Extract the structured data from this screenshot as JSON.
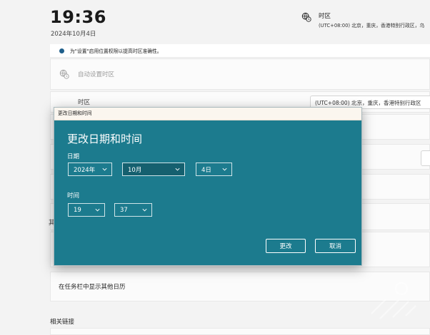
{
  "clock": {
    "time": "19:36",
    "date": "2024年10月4日"
  },
  "timezone_header": {
    "title": "时区",
    "value": "(UTC+08:00) 北京，重庆，香港特别行政区，乌"
  },
  "info_bar": {
    "text": "为\"设置\"启用位置权限以提高时区准确性。"
  },
  "auto_timezone": {
    "label": "自动设置时区"
  },
  "timezone_row": {
    "label": "时区",
    "selected": "(UTC+08:00) 北京，重庆，香港特别行政区"
  },
  "side_letter": "其",
  "calendar_row": {
    "label": "在任务栏中显示其他日历"
  },
  "related_links": {
    "label": "相关链接"
  },
  "dialog": {
    "window_title": "更改日期和时间",
    "heading": "更改日期和时间",
    "date_label": "日期",
    "time_label": "时间",
    "year": "2024年",
    "month": "10月",
    "day": "4日",
    "hour": "19",
    "minute": "37",
    "change_button": "更改",
    "cancel_button": "取消",
    "accent_color": "#1c7b8e"
  }
}
